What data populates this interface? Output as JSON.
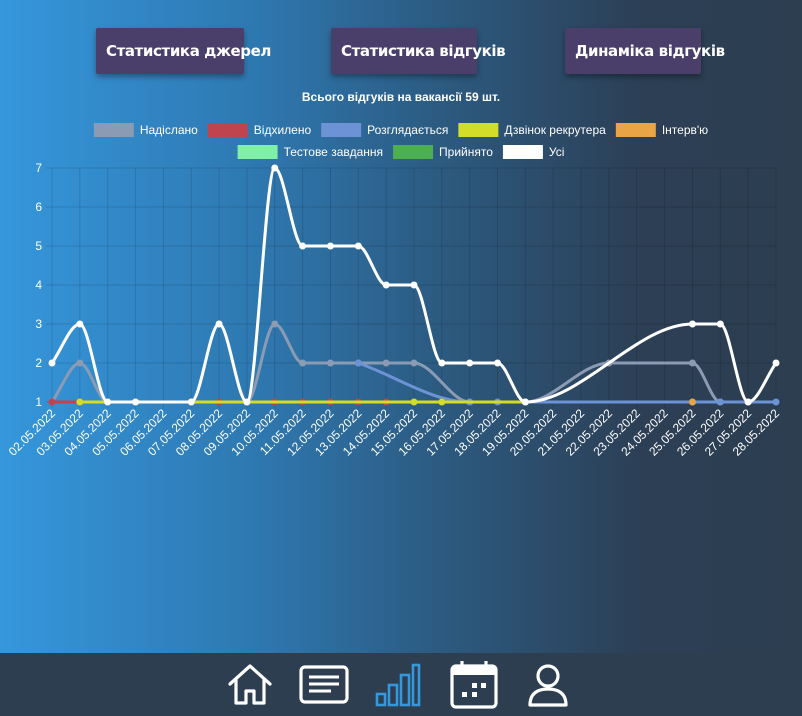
{
  "buttons": {
    "sources": "Статистика джерел",
    "responses": "Статистика відгуків",
    "dynamics": "Динаміка відгуків"
  },
  "chart_title": "Всього відгуків на вакансії 59 шт.",
  "chart_data": {
    "type": "line",
    "x": [
      "02.05.2022",
      "03.05.2022",
      "04.05.2022",
      "05.05.2022",
      "06.05.2022",
      "07.05.2022",
      "08.05.2022",
      "09.05.2022",
      "10.05.2022",
      "11.05.2022",
      "12.05.2022",
      "13.05.2022",
      "14.05.2022",
      "15.05.2022",
      "16.05.2022",
      "17.05.2022",
      "18.05.2022",
      "19.05.2022",
      "20.05.2022",
      "21.05.2022",
      "22.05.2022",
      "23.05.2022",
      "24.05.2022",
      "25.05.2022",
      "26.05.2022",
      "27.05.2022",
      "28.05.2022"
    ],
    "ylim": [
      1,
      7
    ],
    "yticks": [
      1,
      2,
      3,
      4,
      5,
      6,
      7
    ],
    "grid": true,
    "legend_position": "top",
    "series": [
      {
        "name": "Надіслано",
        "color": "#8a9bb3",
        "values": [
          1,
          2,
          1,
          1,
          null,
          1,
          3,
          1,
          3,
          2,
          2,
          2,
          2,
          2,
          null,
          1,
          null,
          1,
          null,
          null,
          2,
          null,
          null,
          2,
          1,
          1,
          null
        ],
        "legend_row": 0
      },
      {
        "name": "Відхилено",
        "color": "#c0444e",
        "values": [
          1,
          1,
          1,
          null,
          null,
          1,
          1,
          1,
          1,
          1,
          1,
          1,
          1,
          null,
          null,
          null,
          null,
          null,
          null,
          null,
          null,
          null,
          null,
          null,
          null,
          null,
          null
        ],
        "legend_row": 0
      },
      {
        "name": "Розглядається",
        "color": "#6d93d6",
        "values": [
          null,
          null,
          null,
          null,
          null,
          null,
          null,
          null,
          null,
          null,
          null,
          2,
          null,
          null,
          null,
          1,
          1,
          1,
          null,
          null,
          null,
          null,
          null,
          1,
          1,
          1,
          1
        ],
        "legend_row": 0
      },
      {
        "name": "Дзвінок рекрутера",
        "color": "#d4dc2a",
        "values": [
          null,
          1,
          null,
          null,
          null,
          null,
          null,
          null,
          null,
          null,
          null,
          null,
          null,
          1,
          1,
          null,
          null,
          1,
          null,
          null,
          null,
          null,
          null,
          null,
          null,
          null,
          null
        ],
        "legend_row": 0
      },
      {
        "name": "Інтерв'ю",
        "color": "#e8a445",
        "values": [
          null,
          null,
          null,
          null,
          null,
          null,
          null,
          null,
          null,
          null,
          null,
          null,
          null,
          null,
          null,
          null,
          null,
          null,
          null,
          null,
          null,
          null,
          null,
          1,
          null,
          null,
          null
        ],
        "legend_row": 0
      },
      {
        "name": "Тестове завдання",
        "color": "#7ff0a6",
        "values": [
          null,
          null,
          null,
          null,
          null,
          null,
          null,
          null,
          null,
          null,
          null,
          null,
          null,
          null,
          null,
          null,
          null,
          null,
          null,
          null,
          null,
          null,
          null,
          null,
          null,
          null,
          null
        ],
        "legend_row": 1
      },
      {
        "name": "Прийнято",
        "color": "#4cb050",
        "values": [
          null,
          null,
          null,
          null,
          null,
          null,
          null,
          null,
          null,
          null,
          null,
          null,
          null,
          null,
          null,
          null,
          null,
          null,
          null,
          null,
          null,
          null,
          null,
          null,
          null,
          null,
          null
        ],
        "legend_row": 1
      },
      {
        "name": "Усі",
        "color": "#ffffff",
        "values": [
          2,
          3,
          1,
          1,
          null,
          1,
          3,
          1,
          7,
          5,
          5,
          5,
          4,
          4,
          2,
          2,
          2,
          1,
          null,
          null,
          null,
          null,
          null,
          3,
          3,
          1,
          2
        ],
        "legend_row": 1
      }
    ]
  },
  "nav": {
    "items": [
      {
        "name": "home-icon",
        "color": "#ffffff"
      },
      {
        "name": "list-icon",
        "color": "#ffffff"
      },
      {
        "name": "stats-icon",
        "color": "#3498db"
      },
      {
        "name": "calendar-icon",
        "color": "#ffffff"
      },
      {
        "name": "profile-icon",
        "color": "#ffffff"
      }
    ]
  }
}
